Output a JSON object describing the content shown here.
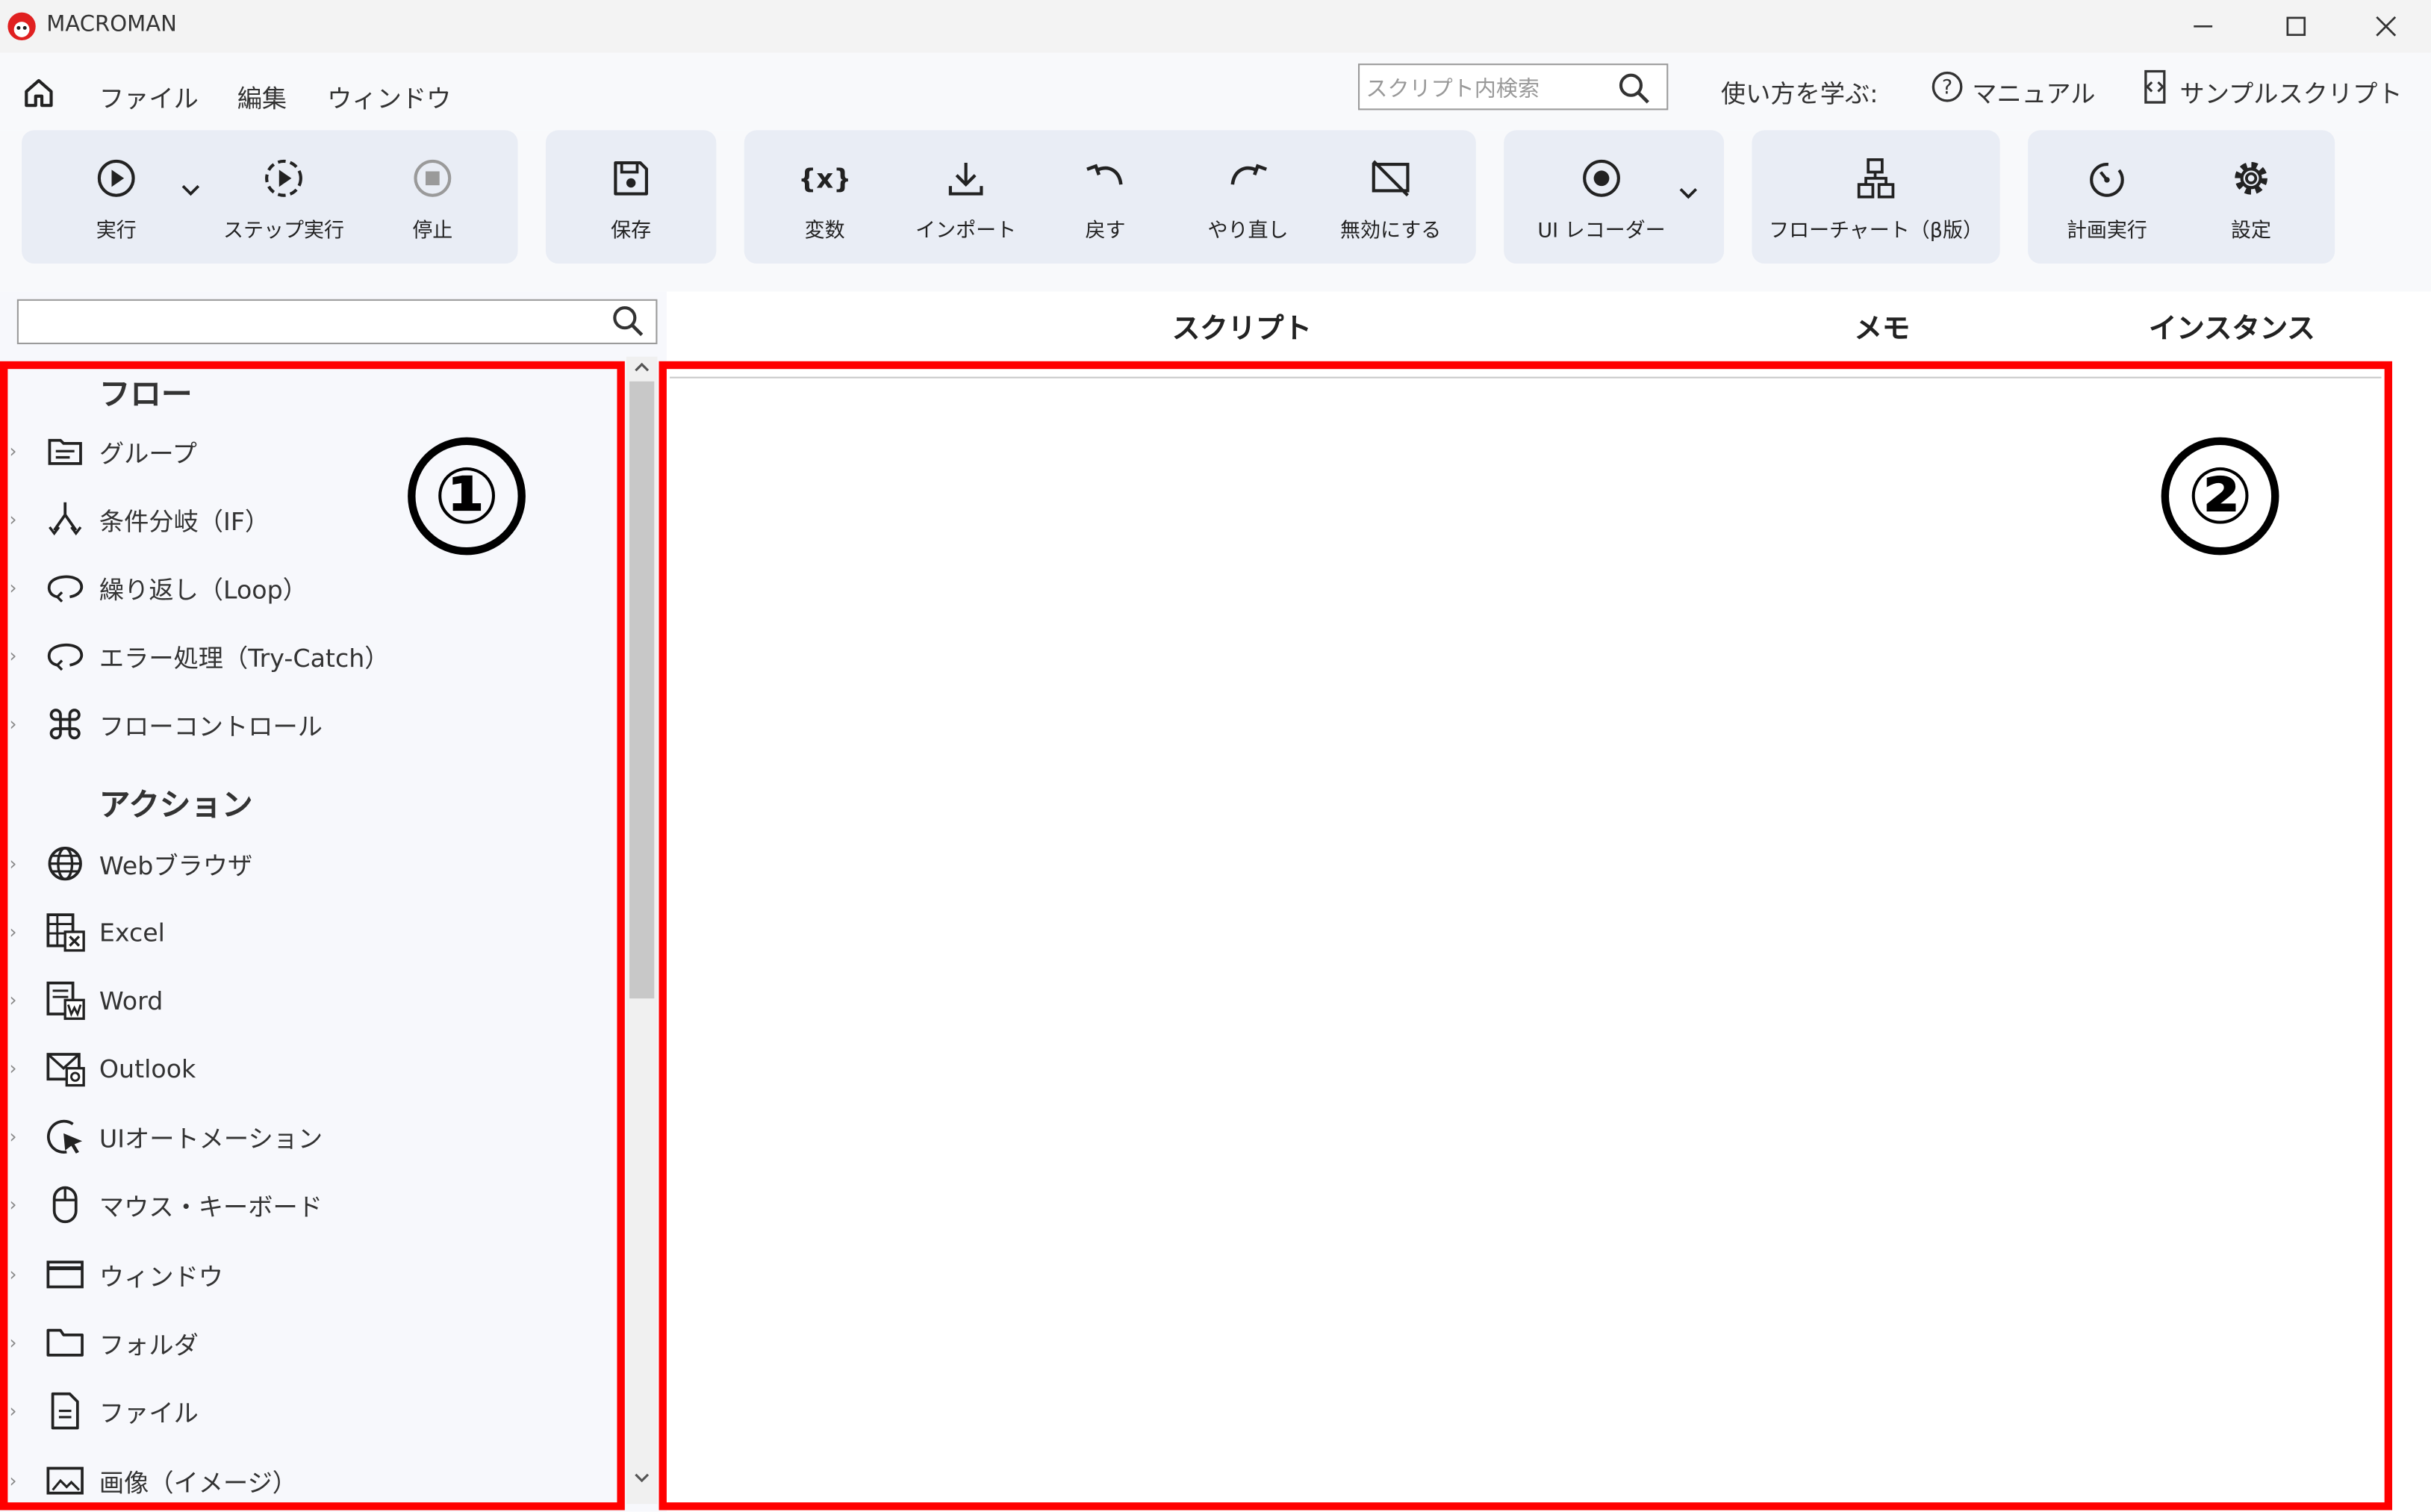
{
  "app": {
    "title": "MACROMAN"
  },
  "menu": {
    "home_icon": "home-icon",
    "items": [
      "ファイル",
      "編集",
      "ウィンドウ"
    ]
  },
  "search": {
    "placeholder": "スクリプト内検索"
  },
  "learn": {
    "label": "使い方を学ぶ:",
    "manual": "マニュアル",
    "sample": "サンプルスクリプト"
  },
  "toolbar": {
    "run": "実行",
    "step_run": "ステップ実行",
    "stop": "停止",
    "save": "保存",
    "variables": "変数",
    "import": "インポート",
    "undo": "戻す",
    "redo": "やり直し",
    "disable": "無効にする",
    "ui_recorder": "UI レコーダー",
    "flowchart": "フローチャート（β版）",
    "schedule": "計画実行",
    "settings": "設定"
  },
  "left_panel": {
    "search_value": "",
    "flow_header": "フロー",
    "flow_items": [
      "グループ",
      "条件分岐（IF）",
      "繰り返し（Loop）",
      "エラー処理（Try-Catch）",
      "フローコントロール"
    ],
    "action_header": "アクション",
    "action_items": [
      "Webブラウザ",
      "Excel",
      "Word",
      "Outlook",
      "UIオートメーション",
      "マウス・キーボード",
      "ウィンドウ",
      "フォルダ",
      "ファイル",
      "画像（イメージ）"
    ]
  },
  "main": {
    "columns": [
      "スクリプト",
      "メモ",
      "インスタンス"
    ]
  },
  "annotations": {
    "left": "①",
    "right": "②",
    "box_color": "#ff0000"
  }
}
